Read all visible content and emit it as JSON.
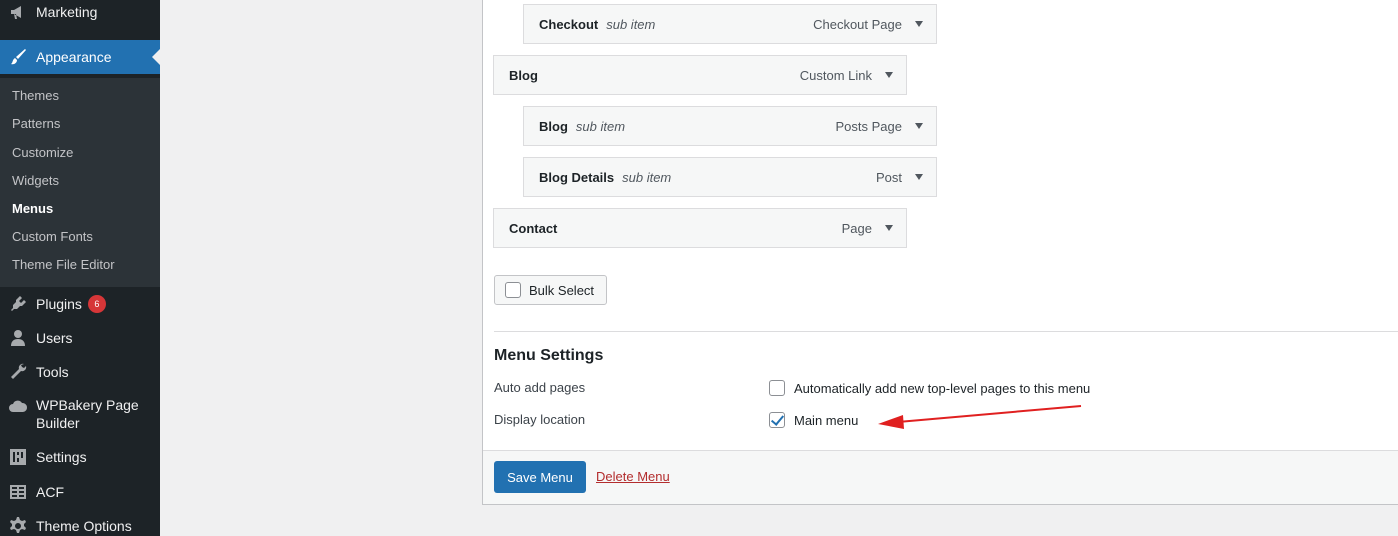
{
  "sidebar": {
    "items": [
      {
        "label": "Marketing",
        "icon": "megaphone-icon"
      },
      {
        "label": "Appearance",
        "icon": "paintbrush-icon",
        "current": true
      },
      {
        "label": "Plugins",
        "icon": "plugin-icon",
        "badge": "6"
      },
      {
        "label": "Users",
        "icon": "user-icon"
      },
      {
        "label": "Tools",
        "icon": "wrench-icon"
      },
      {
        "label": "WPBakery Page Builder",
        "icon": "cloud-icon"
      },
      {
        "label": "Settings",
        "icon": "sliders-icon"
      },
      {
        "label": "ACF",
        "icon": "grid-icon"
      },
      {
        "label": "Theme Options",
        "icon": "gear-icon"
      }
    ],
    "submenu": [
      "Themes",
      "Patterns",
      "Customize",
      "Widgets",
      "Menus",
      "Custom Fonts",
      "Theme File Editor"
    ],
    "active_submenu": "Menus"
  },
  "menu_items": [
    {
      "title": "Checkout",
      "sub": "sub item",
      "type": "Checkout Page",
      "level": 1
    },
    {
      "title": "Blog",
      "sub": "",
      "type": "Custom Link",
      "level": 0
    },
    {
      "title": "Blog",
      "sub": "sub item",
      "type": "Posts Page",
      "level": 1
    },
    {
      "title": "Blog Details",
      "sub": "sub item",
      "type": "Post",
      "level": 1
    },
    {
      "title": "Contact",
      "sub": "",
      "type": "Page",
      "level": 0
    }
  ],
  "bulk_select_label": "Bulk Select",
  "menu_settings": {
    "title": "Menu Settings",
    "auto_add_label": "Auto add pages",
    "auto_add_option": "Automatically add new top-level pages to this menu",
    "auto_add_checked": false,
    "display_location_label": "Display location",
    "display_location_option": "Main menu",
    "display_location_checked": true
  },
  "footer": {
    "save_label": "Save Menu",
    "delete_label": "Delete Menu"
  },
  "colors": {
    "sidebar_bg": "#1d2327",
    "accent": "#2271b1",
    "delete": "#b32d2e",
    "annotation_arrow": "#e02020"
  }
}
